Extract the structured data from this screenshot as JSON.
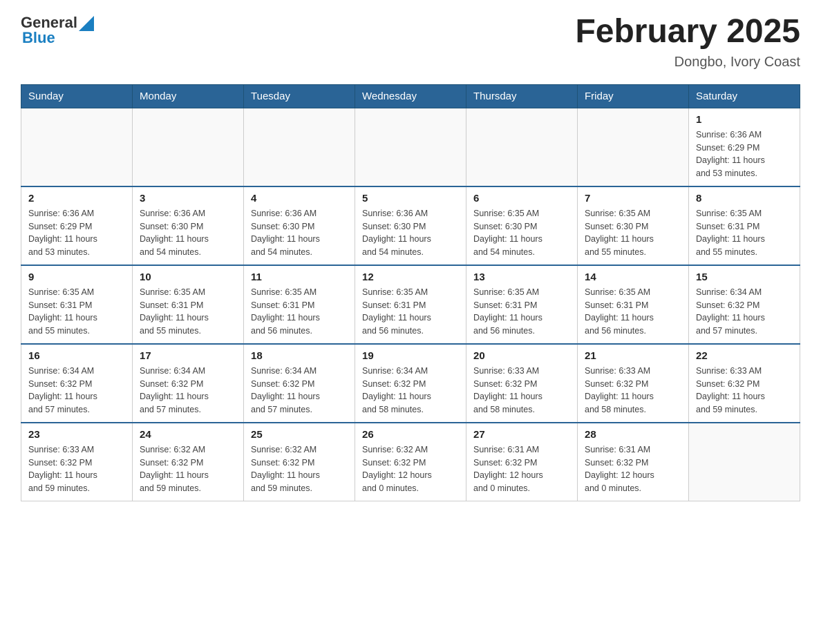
{
  "header": {
    "logo_general": "General",
    "logo_blue": "Blue",
    "title": "February 2025",
    "subtitle": "Dongbo, Ivory Coast"
  },
  "days_of_week": [
    "Sunday",
    "Monday",
    "Tuesday",
    "Wednesday",
    "Thursday",
    "Friday",
    "Saturday"
  ],
  "weeks": [
    [
      {
        "day": "",
        "info": ""
      },
      {
        "day": "",
        "info": ""
      },
      {
        "day": "",
        "info": ""
      },
      {
        "day": "",
        "info": ""
      },
      {
        "day": "",
        "info": ""
      },
      {
        "day": "",
        "info": ""
      },
      {
        "day": "1",
        "info": "Sunrise: 6:36 AM\nSunset: 6:29 PM\nDaylight: 11 hours\nand 53 minutes."
      }
    ],
    [
      {
        "day": "2",
        "info": "Sunrise: 6:36 AM\nSunset: 6:29 PM\nDaylight: 11 hours\nand 53 minutes."
      },
      {
        "day": "3",
        "info": "Sunrise: 6:36 AM\nSunset: 6:30 PM\nDaylight: 11 hours\nand 54 minutes."
      },
      {
        "day": "4",
        "info": "Sunrise: 6:36 AM\nSunset: 6:30 PM\nDaylight: 11 hours\nand 54 minutes."
      },
      {
        "day": "5",
        "info": "Sunrise: 6:36 AM\nSunset: 6:30 PM\nDaylight: 11 hours\nand 54 minutes."
      },
      {
        "day": "6",
        "info": "Sunrise: 6:35 AM\nSunset: 6:30 PM\nDaylight: 11 hours\nand 54 minutes."
      },
      {
        "day": "7",
        "info": "Sunrise: 6:35 AM\nSunset: 6:30 PM\nDaylight: 11 hours\nand 55 minutes."
      },
      {
        "day": "8",
        "info": "Sunrise: 6:35 AM\nSunset: 6:31 PM\nDaylight: 11 hours\nand 55 minutes."
      }
    ],
    [
      {
        "day": "9",
        "info": "Sunrise: 6:35 AM\nSunset: 6:31 PM\nDaylight: 11 hours\nand 55 minutes."
      },
      {
        "day": "10",
        "info": "Sunrise: 6:35 AM\nSunset: 6:31 PM\nDaylight: 11 hours\nand 55 minutes."
      },
      {
        "day": "11",
        "info": "Sunrise: 6:35 AM\nSunset: 6:31 PM\nDaylight: 11 hours\nand 56 minutes."
      },
      {
        "day": "12",
        "info": "Sunrise: 6:35 AM\nSunset: 6:31 PM\nDaylight: 11 hours\nand 56 minutes."
      },
      {
        "day": "13",
        "info": "Sunrise: 6:35 AM\nSunset: 6:31 PM\nDaylight: 11 hours\nand 56 minutes."
      },
      {
        "day": "14",
        "info": "Sunrise: 6:35 AM\nSunset: 6:31 PM\nDaylight: 11 hours\nand 56 minutes."
      },
      {
        "day": "15",
        "info": "Sunrise: 6:34 AM\nSunset: 6:32 PM\nDaylight: 11 hours\nand 57 minutes."
      }
    ],
    [
      {
        "day": "16",
        "info": "Sunrise: 6:34 AM\nSunset: 6:32 PM\nDaylight: 11 hours\nand 57 minutes."
      },
      {
        "day": "17",
        "info": "Sunrise: 6:34 AM\nSunset: 6:32 PM\nDaylight: 11 hours\nand 57 minutes."
      },
      {
        "day": "18",
        "info": "Sunrise: 6:34 AM\nSunset: 6:32 PM\nDaylight: 11 hours\nand 57 minutes."
      },
      {
        "day": "19",
        "info": "Sunrise: 6:34 AM\nSunset: 6:32 PM\nDaylight: 11 hours\nand 58 minutes."
      },
      {
        "day": "20",
        "info": "Sunrise: 6:33 AM\nSunset: 6:32 PM\nDaylight: 11 hours\nand 58 minutes."
      },
      {
        "day": "21",
        "info": "Sunrise: 6:33 AM\nSunset: 6:32 PM\nDaylight: 11 hours\nand 58 minutes."
      },
      {
        "day": "22",
        "info": "Sunrise: 6:33 AM\nSunset: 6:32 PM\nDaylight: 11 hours\nand 59 minutes."
      }
    ],
    [
      {
        "day": "23",
        "info": "Sunrise: 6:33 AM\nSunset: 6:32 PM\nDaylight: 11 hours\nand 59 minutes."
      },
      {
        "day": "24",
        "info": "Sunrise: 6:32 AM\nSunset: 6:32 PM\nDaylight: 11 hours\nand 59 minutes."
      },
      {
        "day": "25",
        "info": "Sunrise: 6:32 AM\nSunset: 6:32 PM\nDaylight: 11 hours\nand 59 minutes."
      },
      {
        "day": "26",
        "info": "Sunrise: 6:32 AM\nSunset: 6:32 PM\nDaylight: 12 hours\nand 0 minutes."
      },
      {
        "day": "27",
        "info": "Sunrise: 6:31 AM\nSunset: 6:32 PM\nDaylight: 12 hours\nand 0 minutes."
      },
      {
        "day": "28",
        "info": "Sunrise: 6:31 AM\nSunset: 6:32 PM\nDaylight: 12 hours\nand 0 minutes."
      },
      {
        "day": "",
        "info": ""
      }
    ]
  ]
}
